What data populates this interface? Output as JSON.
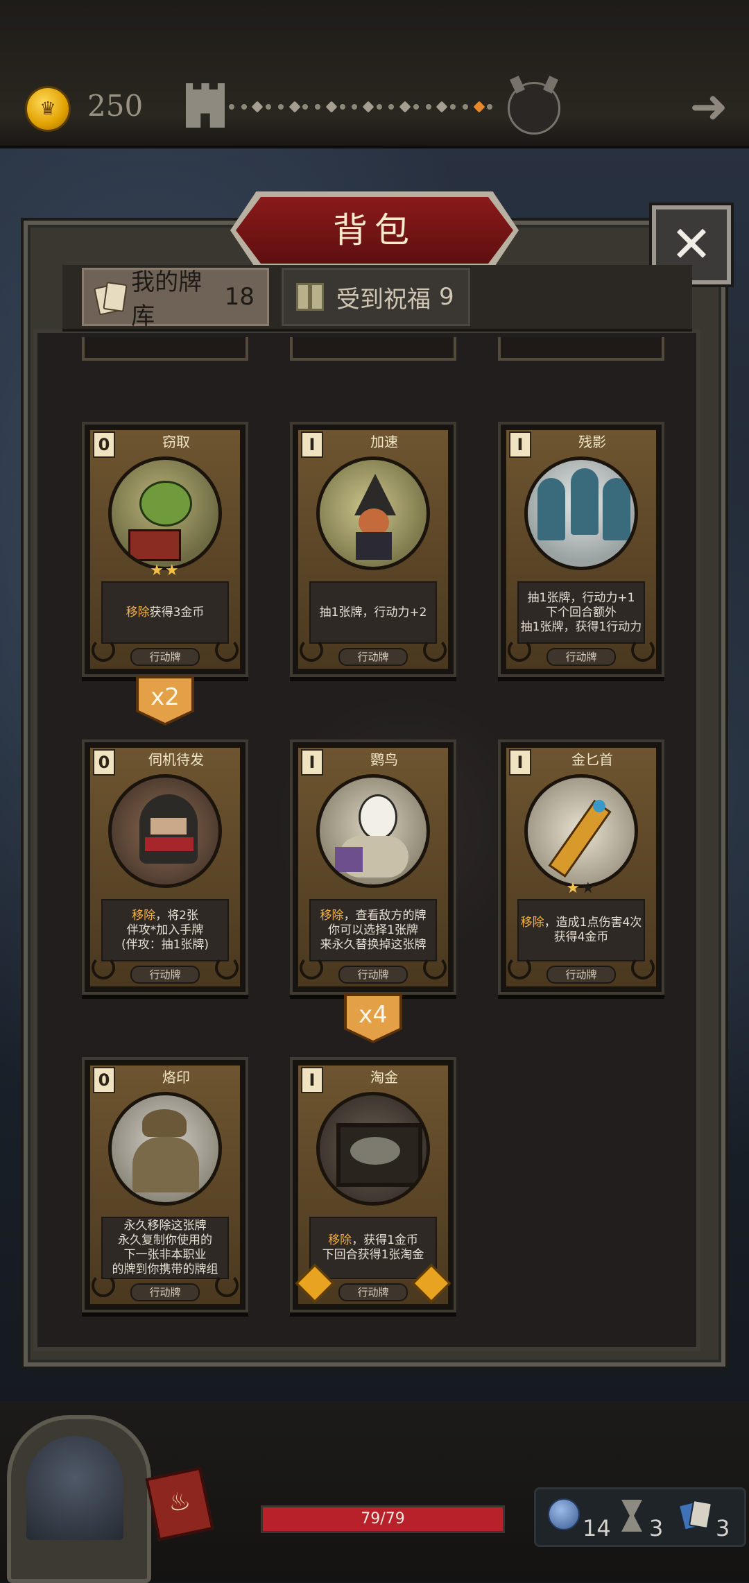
{
  "header": {
    "gold_amount": "250",
    "progress": {
      "total_nodes": 22,
      "current_node": 20
    }
  },
  "panel": {
    "title": "背包",
    "close_label": "✕",
    "tabs": [
      {
        "label": "我的牌库",
        "count": "18",
        "icon": "cards-icon",
        "active": true
      },
      {
        "label": "受到祝福",
        "count": "9",
        "icon": "gift-icon",
        "active": false
      }
    ]
  },
  "cards": [
    {
      "cost": "0",
      "name": "窃取",
      "stars": 2,
      "stars_max": 2,
      "desc_kw": "移除",
      "desc": "获得3金币",
      "type": "行动牌",
      "count": "x2",
      "art": "goblin"
    },
    {
      "cost": "I",
      "name": "加速",
      "stars": 0,
      "stars_max": 0,
      "desc_kw": "",
      "desc": "抽1张牌，行动力+2",
      "type": "行动牌",
      "count": "",
      "art": "witch"
    },
    {
      "cost": "I",
      "name": "残影",
      "stars": 0,
      "stars_max": 0,
      "desc_kw": "",
      "desc": "抽1张牌，行动力+1\n下个回合额外\n抽1张牌，获得1行动力",
      "type": "行动牌",
      "count": "",
      "art": "ghosts"
    },
    {
      "cost": "0",
      "name": "伺机待发",
      "stars": 0,
      "stars_max": 0,
      "desc_kw": "移除",
      "desc": "，将2张\n伴攻*加入手牌\n(伴攻：抽1张牌)",
      "type": "行动牌",
      "count": "",
      "art": "rogue"
    },
    {
      "cost": "I",
      "name": "鹦鸟",
      "stars": 0,
      "stars_max": 0,
      "desc_kw": "移除",
      "desc": "，查看敌方的牌\n你可以选择1张牌\n来永久替换掉这张牌",
      "type": "行动牌",
      "count": "x4",
      "art": "bird"
    },
    {
      "cost": "I",
      "name": "金匕首",
      "stars": 1,
      "stars_max": 2,
      "desc_kw": "移除",
      "desc": "，造成1点伤害4次\n获得4金币",
      "type": "行动牌",
      "count": "",
      "art": "dagger"
    },
    {
      "cost": "0",
      "name": "烙印",
      "stars": 0,
      "stars_max": 0,
      "desc_kw": "",
      "desc": "永久移除这张牌\n永久复制你使用的\n下一张非本职业\n的牌到你携带的牌组",
      "type": "行动牌",
      "count": "",
      "art": "seal"
    },
    {
      "cost": "I",
      "name": "淘金",
      "stars": 0,
      "stars_max": 0,
      "desc_kw": "移除",
      "desc": "，获得1金币\n下回合获得1张淘金",
      "type": "行动牌",
      "count": "",
      "art": "pan",
      "gold_frame": true
    }
  ],
  "footer": {
    "hp_text": "79/79",
    "hp_fraction": 1.0,
    "stats": [
      {
        "icon": "orb-icon",
        "value": "14"
      },
      {
        "icon": "hourglass-icon",
        "value": "3"
      },
      {
        "icon": "cards-stack-icon",
        "value": "3"
      }
    ]
  },
  "colors": {
    "accent_red": "#b8212a",
    "keyword_gold": "#f2b03e",
    "badge_orange": "#e4a047"
  }
}
